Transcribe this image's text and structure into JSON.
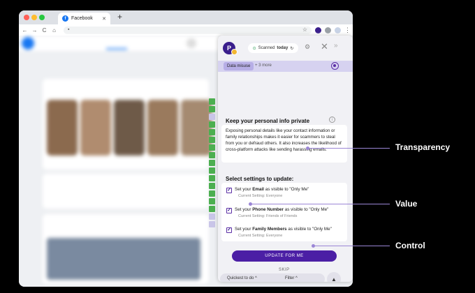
{
  "browser": {
    "tab_title": "Facebook",
    "tab_favicon_letter": "f",
    "new_tab": "+",
    "nav": {
      "back": "←",
      "forward": "→",
      "reload": "C",
      "home": "⌂"
    },
    "menu": "⋮"
  },
  "panel": {
    "logo_text": "P",
    "scan_status": {
      "prefix": "Scanned",
      "emph": "today"
    },
    "close": "✕",
    "collapse": "»",
    "filter_chip": "Data misuse",
    "filter_more": "+ 3 more",
    "heading": "Keep your personal info private",
    "info_icon": "i",
    "description": "Exposing personal details like your contact information or family relationships makes it easier for scammers to steal from you or defraud others. It also increases the likelihood of cross-platform attacks like sending harassing emails.",
    "settings_title": "Select settings to update:",
    "settings": [
      {
        "pre": "Set your",
        "field": "Email",
        "post": "as visible to \"Only Me\"",
        "current": "Current Setting: Everyone",
        "checked": true
      },
      {
        "pre": "Set your",
        "field": "Phone Number",
        "post": "as visible to \"Only Me\"",
        "current": "Current Setting: Friends of Friends",
        "checked": true
      },
      {
        "pre": "Set your",
        "field": "Family Members",
        "post": "as visible to \"Only Me\"",
        "current": "Current Setting: Everyone",
        "checked": true
      }
    ],
    "update_button": "UPDATE FOR ME",
    "skip": "SKIP",
    "sort": "Quickest to do ^",
    "filter": "Filter ^",
    "up": "▲"
  },
  "annotations": {
    "transparency": "Transparency",
    "value": "Value",
    "control": "Control"
  },
  "colors": {
    "accent": "#4b1fa5",
    "annotation": "#9b86d6"
  }
}
